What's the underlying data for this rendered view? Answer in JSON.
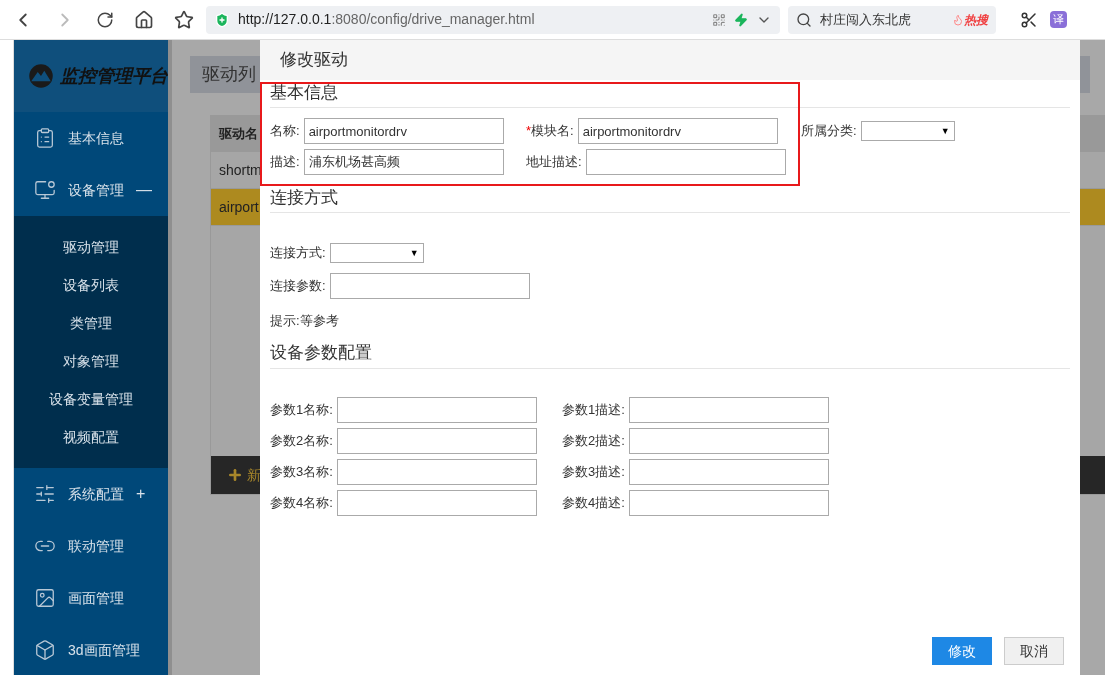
{
  "browser": {
    "url_host": "http://127.0.0.1",
    "url_rest": ":8080/config/drive_manager.html",
    "search": "村庄闯入东北虎",
    "hot_badge": "热搜",
    "translate": "译"
  },
  "app": {
    "title": "监控管理平台"
  },
  "sidebar": {
    "items": [
      {
        "label": "基本信息"
      },
      {
        "label": "设备管理",
        "toggle": "—",
        "expanded": true,
        "children": [
          {
            "label": "驱动管理"
          },
          {
            "label": "设备列表"
          },
          {
            "label": "类管理"
          },
          {
            "label": "对象管理"
          },
          {
            "label": "设备变量管理"
          },
          {
            "label": "视频配置"
          }
        ]
      },
      {
        "label": "系统配置",
        "toggle": "+"
      },
      {
        "label": "联动管理"
      },
      {
        "label": "画面管理"
      },
      {
        "label": "3d画面管理"
      }
    ]
  },
  "background_panel": {
    "title": "驱动列",
    "table": {
      "columns": [
        "驱动名"
      ],
      "rows": [
        {
          "cells": [
            "shortm"
          ],
          "selected": false
        },
        {
          "cells": [
            "airport"
          ],
          "selected": true
        }
      ]
    },
    "add_button": "新"
  },
  "dialog": {
    "title": "修改驱动",
    "sections": [
      {
        "title": "基本信息",
        "highlighted": true,
        "rows": [
          [
            {
              "label": "名称:",
              "kind": "input",
              "value": "airportmonitordrv"
            },
            {
              "required_mark": "*",
              "label": "模块名:",
              "kind": "input",
              "value": "airportmonitordrv"
            },
            {
              "label": "所属分类:",
              "kind": "select",
              "arrow": "▼"
            }
          ],
          [
            {
              "label": "描述:",
              "kind": "input",
              "value": "浦东机场甚高频"
            },
            {
              "label": "地址描述:",
              "kind": "input"
            }
          ]
        ]
      },
      {
        "title": "连接方式",
        "rows": [
          [
            {
              "label": "连接方式:",
              "kind": "select",
              "arrow": "▼"
            }
          ],
          [
            {
              "label": "连接参数:",
              "kind": "input"
            }
          ]
        ],
        "hint": "提示:等参考"
      },
      {
        "title": "设备参数配置",
        "rows": [
          [
            {
              "label": "参数1名称:",
              "kind": "input"
            },
            {
              "label": "参数1描述:",
              "kind": "input"
            }
          ],
          [
            {
              "label": "参数2名称:",
              "kind": "input"
            },
            {
              "label": "参数2描述:",
              "kind": "input"
            }
          ],
          [
            {
              "label": "参数3名称:",
              "kind": "input"
            },
            {
              "label": "参数3描述:",
              "kind": "input"
            }
          ],
          [
            {
              "label": "参数4名称:",
              "kind": "input"
            },
            {
              "label": "参数4描述:",
              "kind": "input"
            }
          ]
        ]
      }
    ],
    "buttons": [
      {
        "label": "修改",
        "kind": "primary"
      },
      {
        "label": "取消",
        "kind": "default"
      }
    ]
  }
}
